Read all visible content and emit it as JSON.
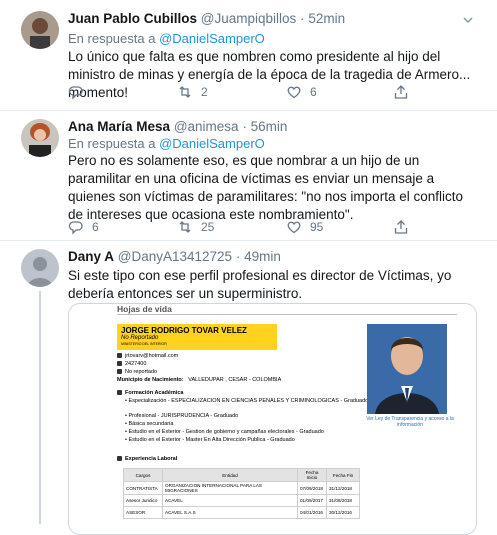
{
  "tweets": [
    {
      "name": "Juan Pablo Cubillos",
      "handle": "@Juampiqbillos",
      "time": "52min",
      "reply_prefix": "En respuesta a",
      "reply_to": "@DanielSamperO",
      "text": "Lo único que falta es que nombren como presidente al hijo del ministro de minas y energía de la época de la tragedia de Armero... momento!",
      "replies": "",
      "retweets": "2",
      "likes": "6"
    },
    {
      "name": "Ana María Mesa",
      "handle": "@animesa",
      "time": "56min",
      "reply_prefix": "En respuesta a",
      "reply_to": "@DanielSamperO",
      "text": "Pero no es solamente eso, es que nombrar a un hijo de un paramilitar en una oficina de víctimas es enviar un mensaje a quienes son víctimas de paramilitares: \"no nos importa el conflicto de intereses que ocasiona este nombramiento\".",
      "replies": "6",
      "retweets": "25",
      "likes": "95"
    },
    {
      "name": "Dany A",
      "handle": "@DanyA13412725",
      "time": "49min",
      "text": "Si este tipo con ese perfil profesional es director de Víctimas, yo debería entonces ser un superministro."
    }
  ],
  "sep": "·",
  "doc": {
    "heading": "Hojas de vida",
    "person_name": "JORGE RODRIGO TOVAR VELEZ",
    "status": "No Reportado",
    "entity": "MINISTERIO DEL INTERIOR",
    "email": "jrtovarv@hotmail.com",
    "phone": "2427400",
    "other": "No reportado",
    "birthplace_label": "Municipio de Nacimiento:",
    "birthplace": "VALLEDUPAR , CESAR - COLOMBIA",
    "formation_label": "Formación Académica",
    "formation": [
      "Especialización - ESPECIALIZACION EN CIENCIAS PENALES Y CRIMINOLOGICAS - Graduado",
      "Profesional - JURISPRUDENCIA - Graduado",
      "Básica secundaria",
      "Estudio en el Exterior - Gestion de gobierno y campañas electorales - Graduado",
      "Estudio en el Exterior - Master En Alta Dirección Publica - Graduado"
    ],
    "photo_caption": "Ver Ley de Transparencia y acceso a la información",
    "experience_label": "Experiencia Laboral",
    "table_headers": [
      "Cargos",
      "Entidad",
      "Fecha Inicio",
      "Fecha Fin"
    ],
    "table_rows": [
      [
        "CONTRATISTA",
        "ORGANIZACION INTERNACIONAL PARA LAS MIGRACIONES",
        "07/09/2018",
        "31/12/2018"
      ],
      [
        "Asesor Juridico",
        "ACAVEL",
        "01/09/2017",
        "31/08/2018"
      ],
      [
        "ASESOR",
        "ACAVEL S.A.S",
        "04/01/2016",
        "30/12/2016"
      ]
    ]
  }
}
